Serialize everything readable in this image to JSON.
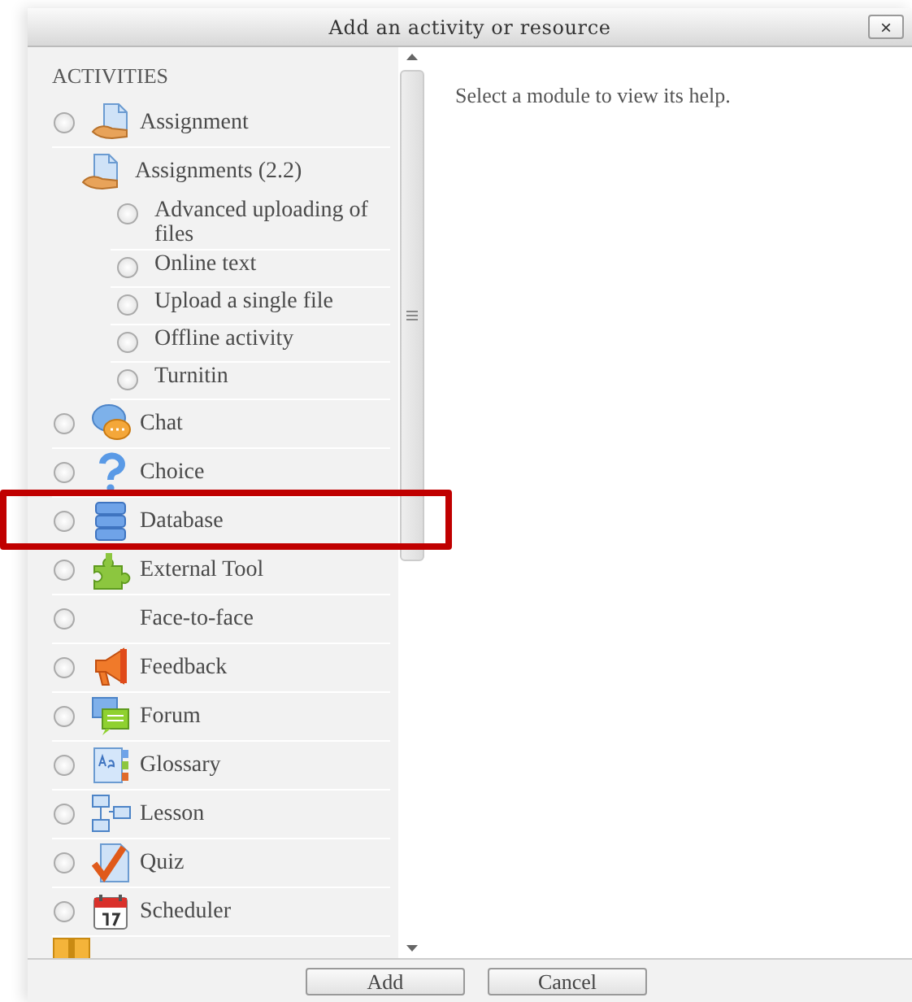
{
  "window": {
    "title": "Add an activity or resource",
    "close": "×"
  },
  "section_heading": "ACTIVITIES",
  "items": [
    {
      "kind": "module",
      "label": "Assignment",
      "selected": false,
      "children": [
        {
          "kind": "group",
          "label": "Assignments (2.2)",
          "children": [
            {
              "kind": "sub",
              "label": "Advanced uploading of files",
              "selected": false
            },
            {
              "kind": "sub",
              "label": "Online text",
              "selected": false
            },
            {
              "kind": "sub",
              "label": "Upload a single file",
              "selected": false
            },
            {
              "kind": "sub",
              "label": "Offline activity",
              "selected": false
            },
            {
              "kind": "sub",
              "label": "Turnitin",
              "selected": false
            }
          ]
        }
      ]
    },
    {
      "kind": "module",
      "label": "Chat",
      "selected": false
    },
    {
      "kind": "module",
      "label": "Choice",
      "selected": false
    },
    {
      "kind": "module",
      "label": "Database",
      "selected": false,
      "highlighted": true
    },
    {
      "kind": "module",
      "label": "External Tool",
      "selected": false
    },
    {
      "kind": "module",
      "label": "Face-to-face",
      "selected": false
    },
    {
      "kind": "module",
      "label": "Feedback",
      "selected": false
    },
    {
      "kind": "module",
      "label": "Forum",
      "selected": false
    },
    {
      "kind": "module",
      "label": "Glossary",
      "selected": false
    },
    {
      "kind": "module",
      "label": "Lesson",
      "selected": false
    },
    {
      "kind": "module",
      "label": "Quiz",
      "selected": false
    },
    {
      "kind": "module",
      "label": "Scheduler",
      "selected": false
    },
    {
      "kind": "partial"
    }
  ],
  "help_text": "Select a module to view its help.",
  "buttons": [
    {
      "label": "Add"
    },
    {
      "label": "Cancel"
    }
  ]
}
